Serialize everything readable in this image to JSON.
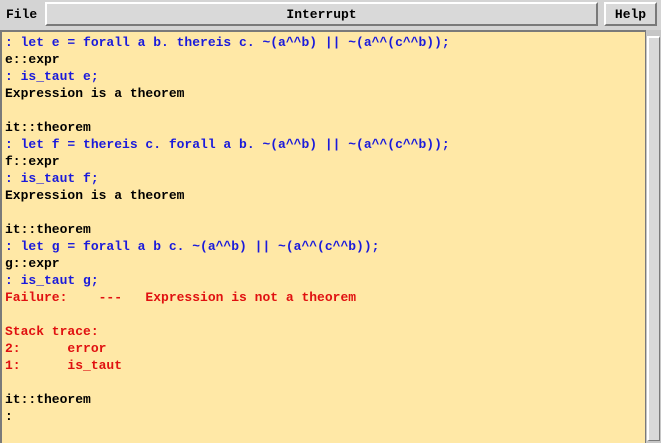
{
  "menubar": {
    "file_label": "File",
    "interrupt_label": "Interrupt",
    "help_label": "Help"
  },
  "colors": {
    "input": "#1a1adb",
    "output": "#000000",
    "error": "#e01010",
    "background": "#ffe8a6"
  },
  "terminal": {
    "lines": [
      {
        "text": ": let e = forall a b. thereis c. ~(a^^b) || ~(a^^(c^^b));",
        "kind": "input"
      },
      {
        "text": "e::expr",
        "kind": "output"
      },
      {
        "text": ": is_taut e;",
        "kind": "input"
      },
      {
        "text": "Expression is a theorem",
        "kind": "output"
      },
      {
        "text": "",
        "kind": "output"
      },
      {
        "text": "it::theorem",
        "kind": "output"
      },
      {
        "text": ": let f = thereis c. forall a b. ~(a^^b) || ~(a^^(c^^b));",
        "kind": "input"
      },
      {
        "text": "f::expr",
        "kind": "output"
      },
      {
        "text": ": is_taut f;",
        "kind": "input"
      },
      {
        "text": "Expression is a theorem",
        "kind": "output"
      },
      {
        "text": "",
        "kind": "output"
      },
      {
        "text": "it::theorem",
        "kind": "output"
      },
      {
        "text": ": let g = forall a b c. ~(a^^b) || ~(a^^(c^^b));",
        "kind": "input"
      },
      {
        "text": "g::expr",
        "kind": "output"
      },
      {
        "text": ": is_taut g;",
        "kind": "input"
      },
      {
        "text": "Failure:    ---   Expression is not a theorem",
        "kind": "error"
      },
      {
        "text": "",
        "kind": "output"
      },
      {
        "text": "Stack trace:",
        "kind": "error"
      },
      {
        "text": "2:      error",
        "kind": "error"
      },
      {
        "text": "1:      is_taut",
        "kind": "error"
      },
      {
        "text": "",
        "kind": "output"
      },
      {
        "text": "it::theorem",
        "kind": "output"
      },
      {
        "text": ":",
        "kind": "output"
      }
    ]
  }
}
